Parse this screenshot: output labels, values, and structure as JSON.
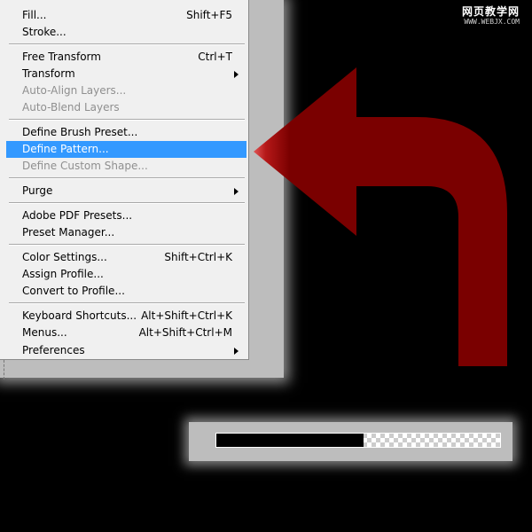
{
  "edit_menu": {
    "items": [
      {
        "label": "Fill...",
        "shortcut": "Shift+F5",
        "disabled": false
      },
      {
        "label": "Stroke...",
        "shortcut": "",
        "disabled": false
      },
      {
        "label": "Free Transform",
        "shortcut": "Ctrl+T",
        "disabled": false
      },
      {
        "label": "Transform",
        "shortcut": "",
        "disabled": false,
        "submenu": true
      },
      {
        "label": "Auto-Align Layers...",
        "shortcut": "",
        "disabled": true
      },
      {
        "label": "Auto-Blend Layers",
        "shortcut": "",
        "disabled": true
      },
      {
        "label": "Define Brush Preset...",
        "shortcut": "",
        "disabled": false
      },
      {
        "label": "Define Pattern...",
        "shortcut": "",
        "disabled": false,
        "highlighted": true
      },
      {
        "label": "Define Custom Shape...",
        "shortcut": "",
        "disabled": true
      },
      {
        "label": "Purge",
        "shortcut": "",
        "disabled": false,
        "submenu": true
      },
      {
        "label": "Adobe PDF Presets...",
        "shortcut": "",
        "disabled": false
      },
      {
        "label": "Preset Manager...",
        "shortcut": "",
        "disabled": false
      },
      {
        "label": "Color Settings...",
        "shortcut": "Shift+Ctrl+K",
        "disabled": false
      },
      {
        "label": "Assign Profile...",
        "shortcut": "",
        "disabled": false
      },
      {
        "label": "Convert to Profile...",
        "shortcut": "",
        "disabled": false
      },
      {
        "label": "Keyboard Shortcuts...",
        "shortcut": "Alt+Shift+Ctrl+K",
        "disabled": false
      },
      {
        "label": "Menus...",
        "shortcut": "Alt+Shift+Ctrl+M",
        "disabled": false
      },
      {
        "label": "Preferences",
        "shortcut": "",
        "disabled": false,
        "submenu": true
      }
    ]
  },
  "progress": {
    "filled_fraction": 0.52
  },
  "watermark": {
    "main": "网页教学网",
    "sub": "WWW.WEBJX.COM"
  },
  "icons": {
    "submenu_arrow": "chevron-right-icon",
    "pointer_arrow": "u-turn-arrow-icon"
  },
  "colors": {
    "highlight": "#3399ff",
    "arrow_body": "#7a0000",
    "arrow_head_tip": "#e05555",
    "menu_background": "#f0f0f0",
    "disabled_text": "#8f8f8f"
  }
}
